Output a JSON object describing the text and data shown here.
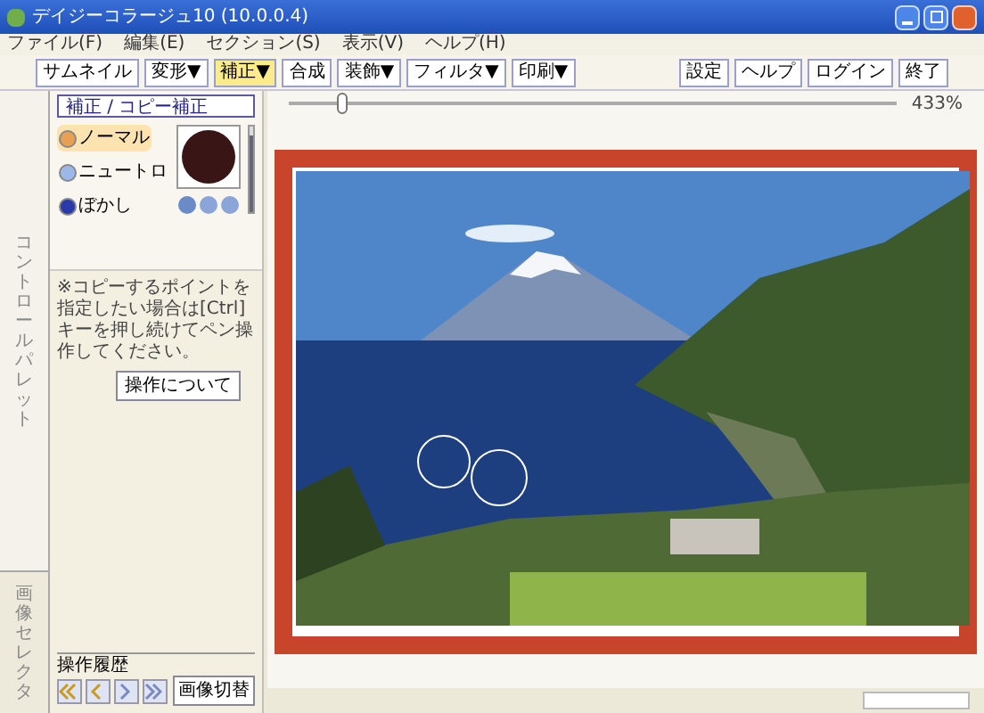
{
  "window": {
    "title": "デイジーコラージュ10 (10.0.0.4)"
  },
  "menu": [
    "ファイル(F)",
    "編集(E)",
    "セクション(S)",
    "表示(V)",
    "ヘルプ(H)"
  ],
  "toolbar": [
    {
      "label": "サムネイル",
      "selected": false
    },
    {
      "label": "変形▼",
      "selected": false
    },
    {
      "label": "補正▼",
      "selected": true
    },
    {
      "label": "合成",
      "selected": false
    },
    {
      "label": "装飾▼",
      "selected": false
    },
    {
      "label": "フィルタ▼",
      "selected": false
    },
    {
      "label": "印刷▼",
      "selected": false
    }
  ],
  "toolbar_right": [
    "設定",
    "ヘルプ",
    "ログイン",
    "終了"
  ],
  "zoom": {
    "level": 0.08,
    "reading": "433%"
  },
  "side_tabs": [
    "コントロールパレット",
    "画像セレクタ"
  ],
  "panel": {
    "title": "補正 / コピー補正",
    "modes": [
      {
        "label": "ノーマル",
        "selected": true
      },
      {
        "label": "ニュートロ",
        "selected": false
      },
      {
        "label": "ぼかし",
        "selected": false
      }
    ],
    "brush_size": {
      "level": 0.9
    },
    "hint": "※コピーするポイントを指定したい場合は[Ctrl]キーを押し続けてペン操作してください。",
    "help_button": "操作について"
  },
  "history": {
    "title": "操作履歴",
    "switch_button": "画像切替"
  }
}
